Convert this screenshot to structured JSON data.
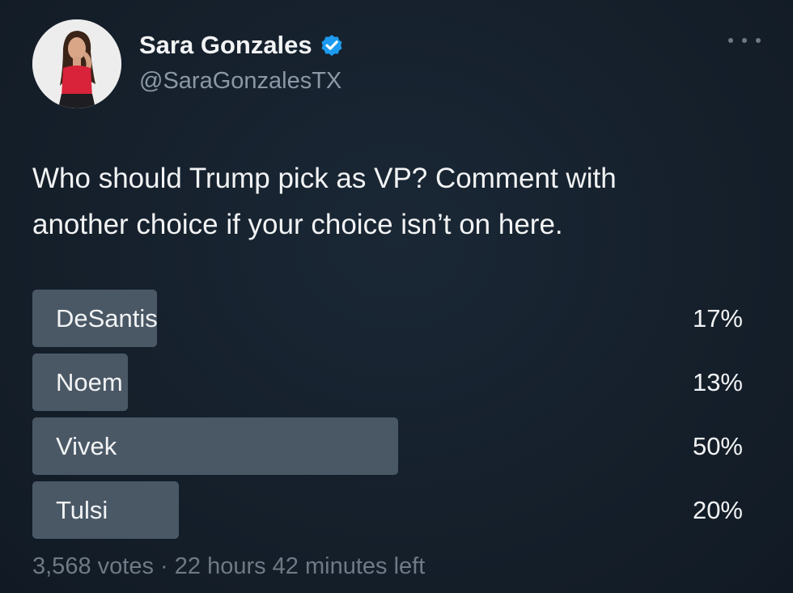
{
  "author": {
    "display_name": "Sara Gonzales",
    "handle": "@SaraGonzalesTX",
    "verified": true
  },
  "tweet": {
    "text_line1": "Who should Trump pick as VP? Comment with",
    "text_line2": "another choice if your choice isn’t on here."
  },
  "poll": {
    "options": [
      {
        "label": "DeSantis",
        "percent": "17%",
        "fraction": 0.17
      },
      {
        "label": "Noem",
        "percent": "13%",
        "fraction": 0.13
      },
      {
        "label": "Vivek",
        "percent": "50%",
        "fraction": 0.5
      },
      {
        "label": "Tulsi",
        "percent": "20%",
        "fraction": 0.2
      }
    ],
    "votes": "3,568 votes",
    "separator": "·",
    "time_left": "22 hours 42 minutes left"
  },
  "colors": {
    "background": "#15202b",
    "bar": "#4a5866",
    "verified_badge": "#1d9bf0",
    "muted_text": "#8b98a5"
  },
  "icons": {
    "verified": "verified-badge-icon",
    "more": "more-options-icon"
  }
}
